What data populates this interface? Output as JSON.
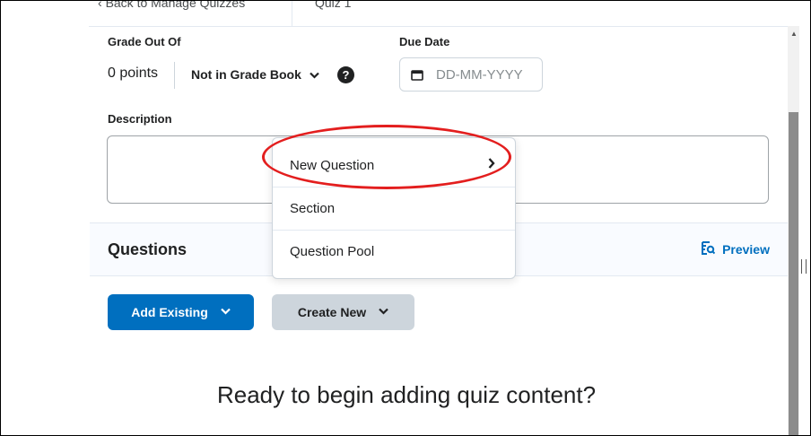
{
  "nav": {
    "back_label": "Back to Manage Quizzes",
    "crumb": "Quiz 1"
  },
  "grade": {
    "label": "Grade Out Of",
    "points": "0 points",
    "gradebook_label": "Not in Grade Book"
  },
  "due_date": {
    "label": "Due Date",
    "placeholder": "DD-MM-YYYY"
  },
  "description": {
    "label": "Description"
  },
  "questions": {
    "title": "Questions",
    "preview_label": "Preview"
  },
  "buttons": {
    "add_existing": "Add Existing",
    "create_new": "Create New"
  },
  "empty_state": "Ready to begin adding quiz content?",
  "menu": {
    "items": [
      {
        "label": "New Question",
        "has_submenu": true
      },
      {
        "label": "Section",
        "has_submenu": false
      },
      {
        "label": "Question Pool",
        "has_submenu": false
      }
    ]
  },
  "colors": {
    "accent": "#006fbf",
    "highlight": "#e31e1e",
    "secondary_button": "#cdd5dc"
  },
  "icons": [
    "chevron-left-icon",
    "chevron-down-icon",
    "help-icon",
    "calendar-icon",
    "preview-icon",
    "chevron-right-icon",
    "scroll-up-icon"
  ]
}
